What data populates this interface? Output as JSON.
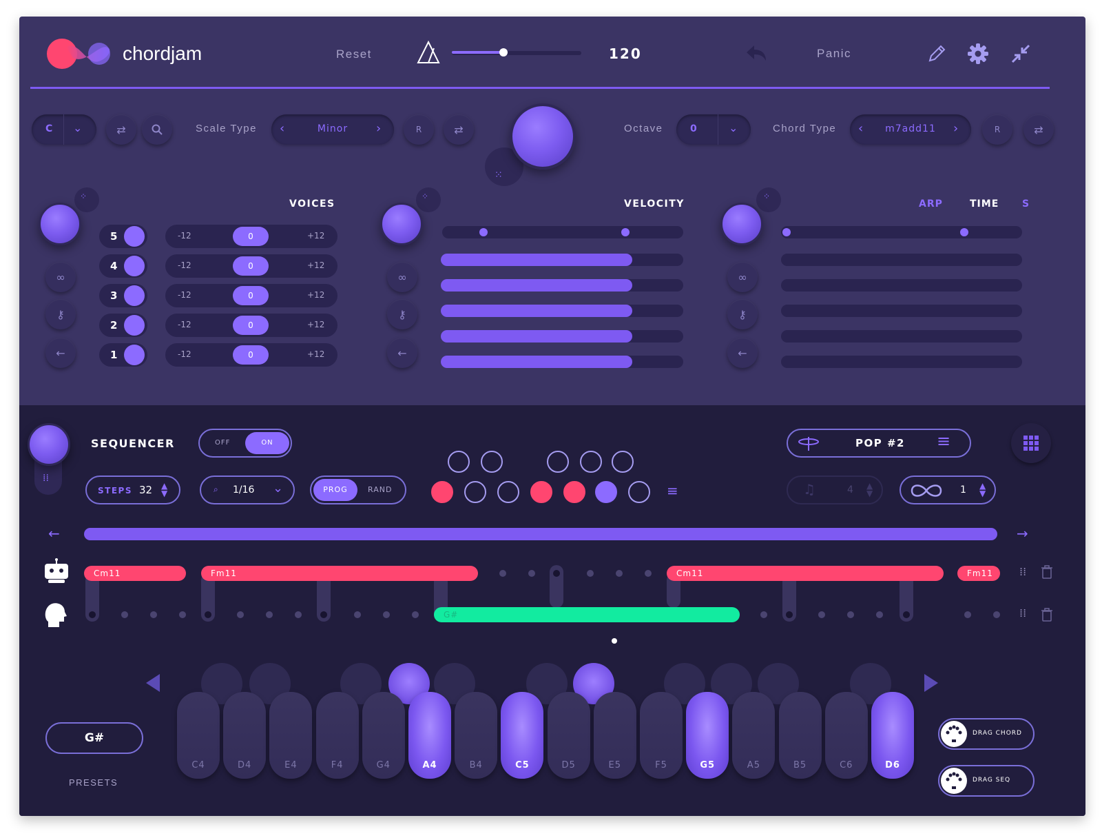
{
  "brand": {
    "name": "chordjam"
  },
  "header": {
    "reset": "Reset",
    "tempo": "120",
    "tempo_fraction": 0.4,
    "panic": "Panic"
  },
  "controls": {
    "key_value": "C",
    "scale_type_label": "Scale Type",
    "scale_value": "Minor",
    "r_label": "R",
    "octave_label": "Octave",
    "octave_value": "0",
    "chord_type_label": "Chord Type",
    "chord_value": "m7add11"
  },
  "voices": {
    "title": "VOICES",
    "rows": [
      {
        "n": "5",
        "low": "-12",
        "val": "0",
        "high": "+12"
      },
      {
        "n": "4",
        "low": "-12",
        "val": "0",
        "high": "+12"
      },
      {
        "n": "3",
        "low": "-12",
        "val": "0",
        "high": "+12"
      },
      {
        "n": "2",
        "low": "-12",
        "val": "0",
        "high": "+12"
      },
      {
        "n": "1",
        "low": "-12",
        "val": "0",
        "high": "+12"
      }
    ]
  },
  "velocity": {
    "title": "VELOCITY",
    "fill_fraction": 0.79
  },
  "time": {
    "arp": "ARP",
    "time": "TIME",
    "s": "S"
  },
  "sequencer": {
    "title": "SEQUENCER",
    "off": "OFF",
    "on": "ON",
    "steps_label": "STEPS",
    "steps_value": "32",
    "quant_value": "1/16",
    "prog": "PROG",
    "rand": "RAND",
    "preset_name": "POP #2",
    "beats_value": "4",
    "loop_value": "1",
    "chords_top": [
      "Cm11",
      "Fm11",
      "Cm11",
      "Fm11"
    ],
    "chord_bottom": "G#"
  },
  "keyboard": {
    "note_display": "G#",
    "presets": "PRESETS",
    "keys": [
      "C4",
      "D4",
      "E4",
      "F4",
      "G4",
      "A4",
      "B4",
      "C5",
      "D5",
      "E5",
      "F5",
      "G5",
      "A5",
      "B5",
      "C6",
      "D6"
    ],
    "active_keys": [
      "A4",
      "C5",
      "G5",
      "D6"
    ],
    "drag_chord": "DRAG CHORD",
    "drag_seq": "DRAG SEQ"
  },
  "colors": {
    "accent": "#8c6bff",
    "red": "#ff4670",
    "green": "#12eba0",
    "panel": "#3b3464",
    "dark": "#211d3d"
  }
}
